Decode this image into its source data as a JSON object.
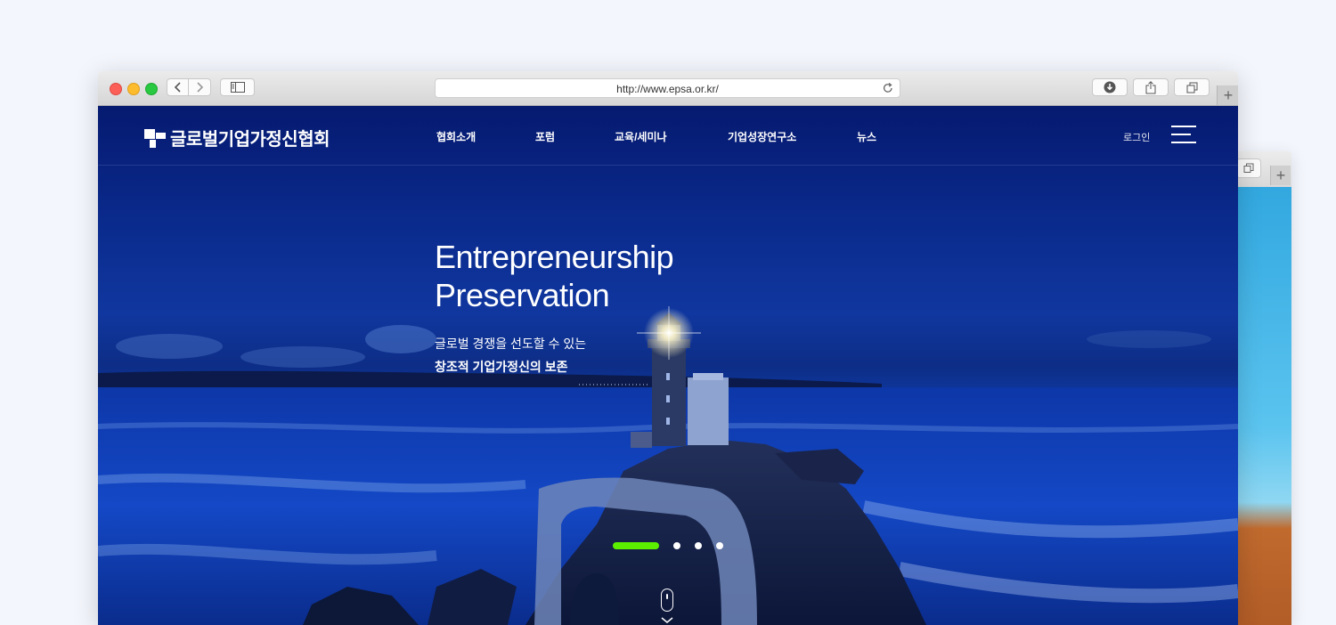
{
  "browser": {
    "url": "http://www.epsa.or.kr/"
  },
  "site": {
    "logo_text": "글로벌기업가정신협회",
    "nav": [
      {
        "label": "협회소개"
      },
      {
        "label": "포럼"
      },
      {
        "label": "교육/세미나"
      },
      {
        "label": "기업성장연구소"
      },
      {
        "label": "뉴스"
      }
    ],
    "login_label": "로그인",
    "menu_icon": "hamburger-icon"
  },
  "hero": {
    "title_line1": "Entrepreneurship",
    "title_line2": "Preservation",
    "subtitle_line1": "글로벌 경쟁을 선도할 수 있는",
    "subtitle_line2": "창조적 기업가정신의 보존",
    "background": "night lighthouse on rocky coast",
    "slide_count": 4,
    "active_slide": 1,
    "pager_active_color": "#5cf000"
  },
  "icons": {
    "back": "chevron-left-icon",
    "forward": "chevron-right-icon",
    "sidebar": "sidebar-icon",
    "reload": "reload-icon",
    "download": "download-icon",
    "share": "share-icon",
    "tabs": "tabs-icon",
    "new_tab": "plus-icon",
    "scroll": "scroll-mouse-icon"
  },
  "colors": {
    "traffic_red": "#fc5f57",
    "traffic_yellow": "#fdbc2e",
    "traffic_green": "#28c840",
    "hero_blue": "#0a2a8c"
  }
}
